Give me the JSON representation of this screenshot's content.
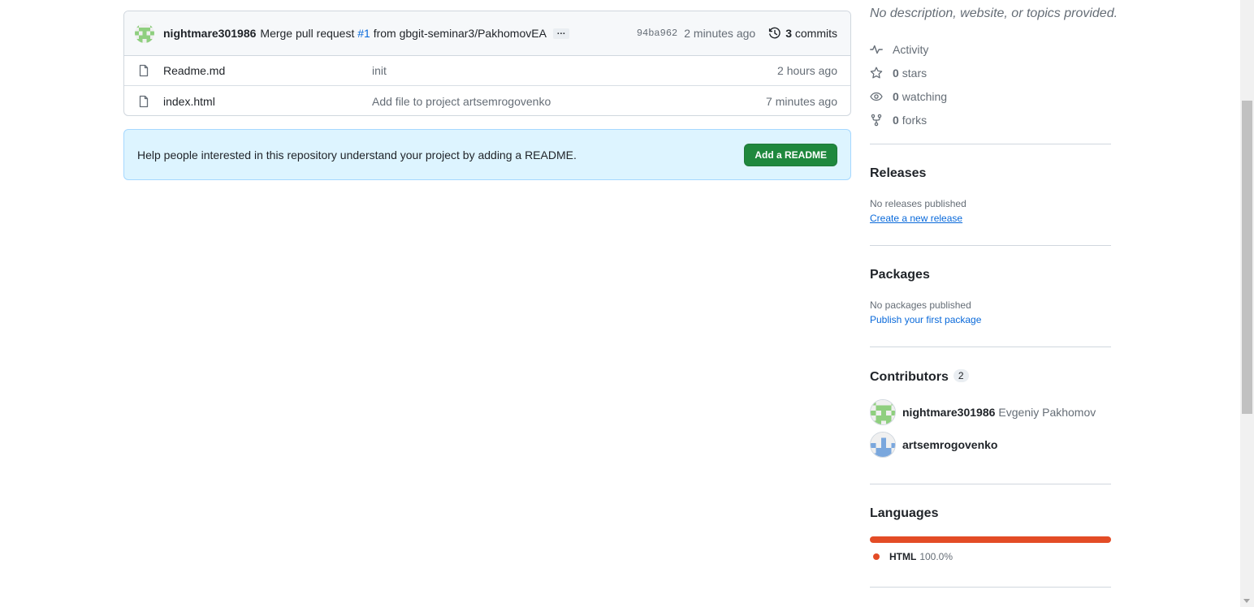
{
  "latest_commit": {
    "author": "nightmare301986",
    "message_prefix": "Merge pull request",
    "pr_number": "#1",
    "message_suffix": "from gbgit-seminar3/PakhomovEA",
    "ellipsis": "…",
    "sha": "94ba962",
    "time": "2 minutes ago",
    "commits_count": "3",
    "commits_label": "commits"
  },
  "files": [
    {
      "name": "Readme.md",
      "commit_message": "init",
      "time": "2 hours ago"
    },
    {
      "name": "index.html",
      "commit_message": "Add file to project artsemrogovenko",
      "time": "7 minutes ago"
    }
  ],
  "readme_banner": {
    "message": "Help people interested in this repository understand your project by adding a README.",
    "button_label": "Add a README"
  },
  "about": {
    "description": "No description, website, or topics provided.",
    "activity_label": "Activity",
    "stars_count": "0",
    "stars_label": "stars",
    "watching_count": "0",
    "watching_label": "watching",
    "forks_count": "0",
    "forks_label": "forks"
  },
  "releases": {
    "title": "Releases",
    "empty_text": "No releases published",
    "link": "Create a new release"
  },
  "packages": {
    "title": "Packages",
    "empty_text": "No packages published",
    "link": "Publish your first package"
  },
  "contributors": {
    "title": "Contributors",
    "count": "2",
    "items": [
      {
        "login": "nightmare301986",
        "name": "Evgeniy Pakhomov"
      },
      {
        "login": "artsemrogovenko",
        "name": ""
      }
    ]
  },
  "languages": {
    "title": "Languages",
    "items": [
      {
        "name": "HTML",
        "percent": "100.0%",
        "color": "#e34c26"
      }
    ]
  },
  "colors": {
    "link": "#0969da",
    "primary_button": "#1f883d",
    "banner_bg": "#ddf4ff"
  }
}
